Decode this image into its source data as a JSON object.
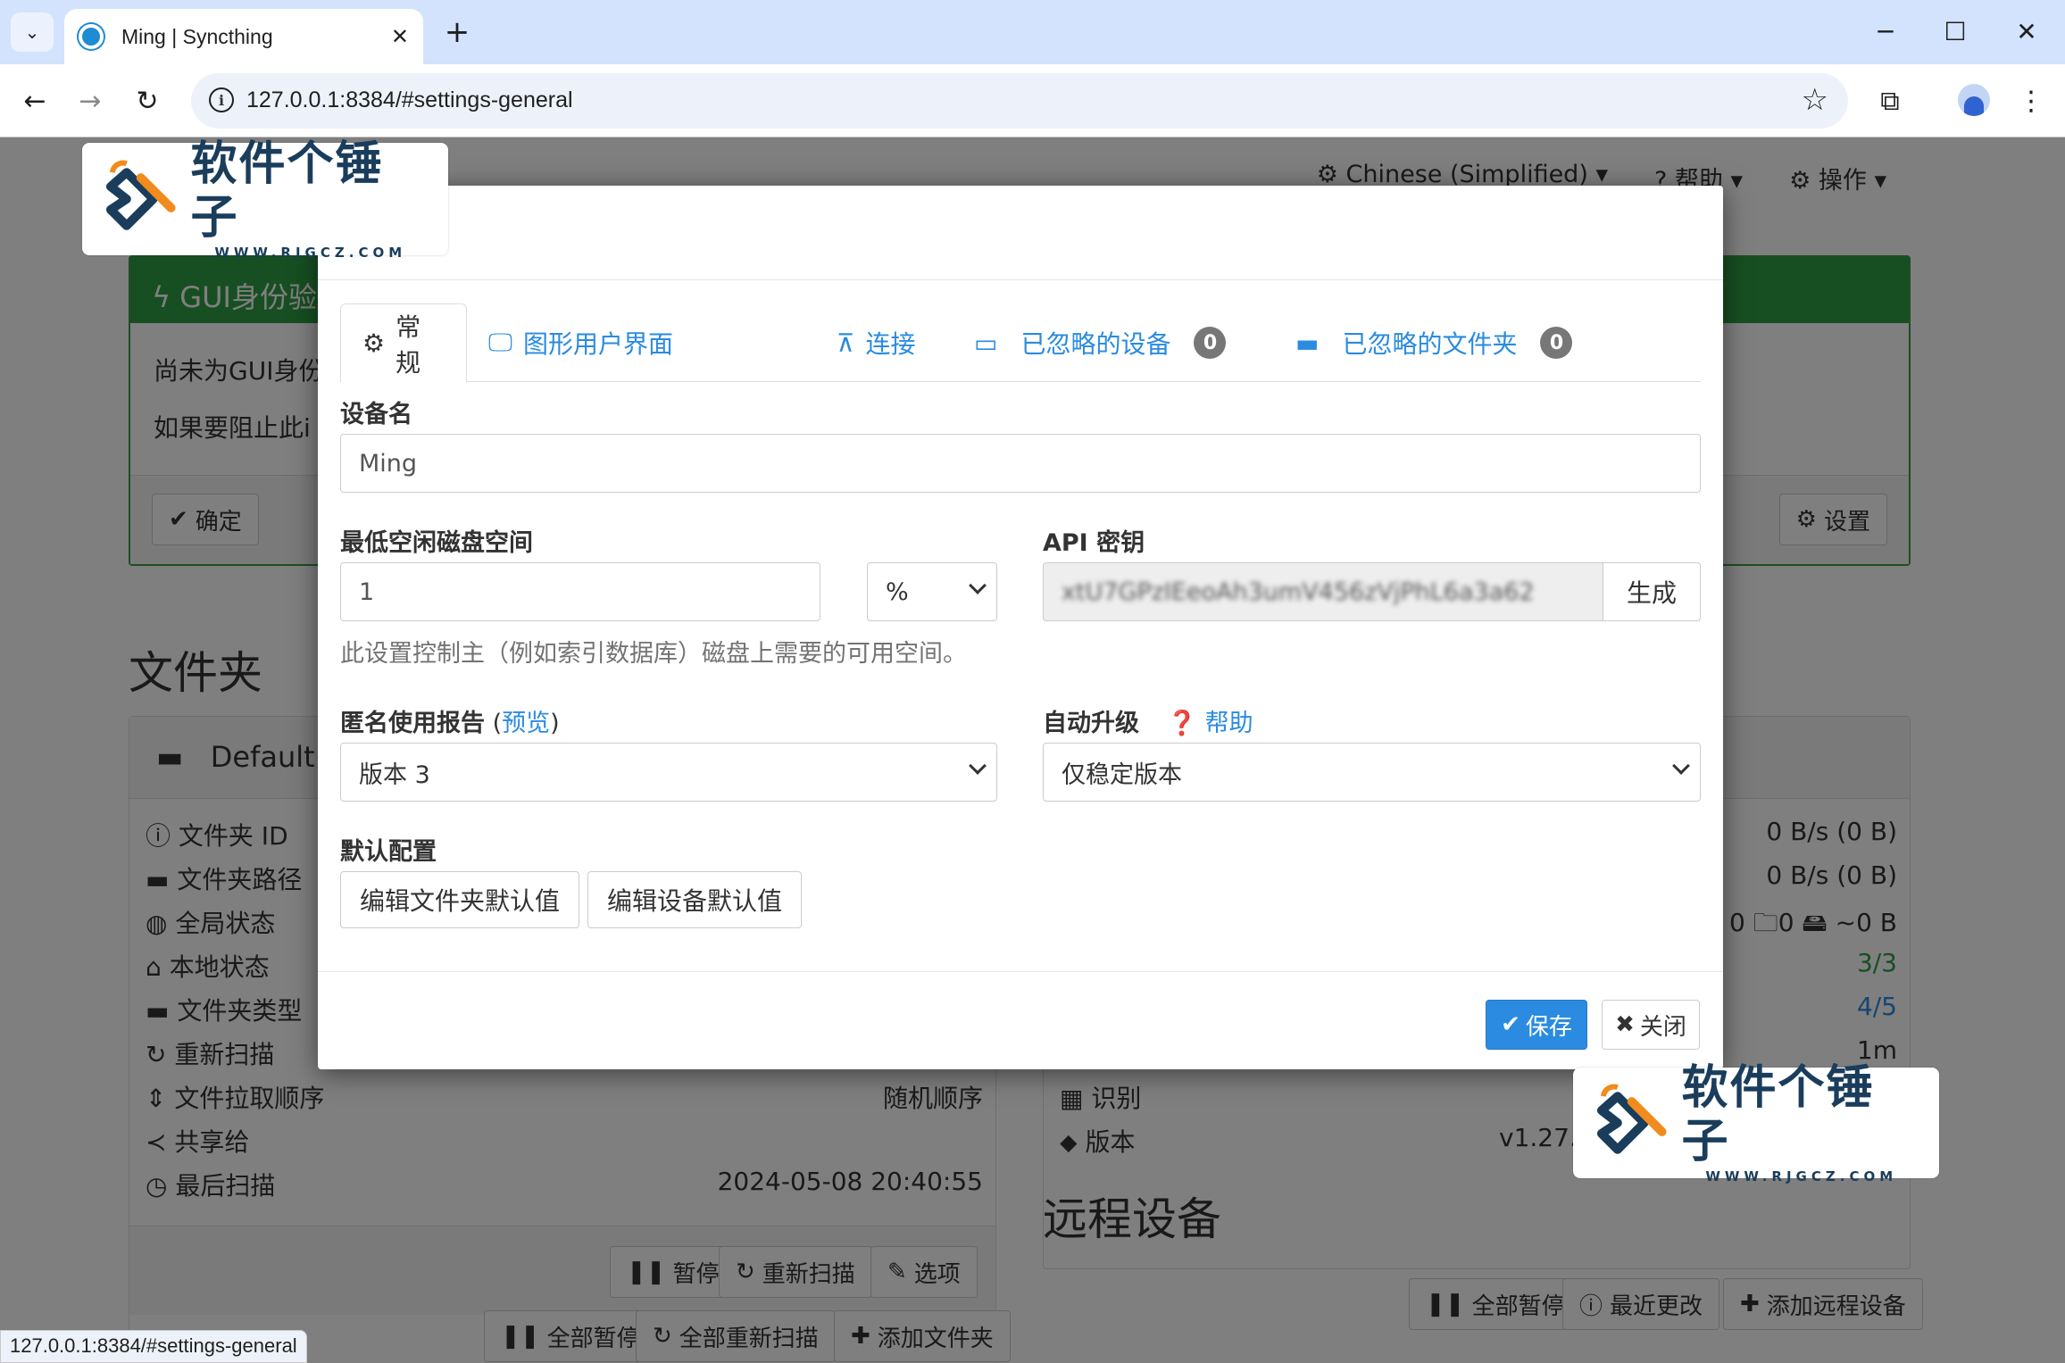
{
  "browser": {
    "tab_title": "Ming | Syncthing",
    "url": "127.0.0.1:8384/#settings-general",
    "status_url": "127.0.0.1:8384/#settings-general"
  },
  "navbar": {
    "language": "Chinese (Simplified)",
    "help": "帮助",
    "actions": "操作"
  },
  "alert": {
    "title": "GUI身份验证",
    "line1": "尚未为GUI身份",
    "line2": "如果要阻止此i",
    "ok_button": "确定",
    "settings_button": "设置"
  },
  "folders": {
    "section_title": "文件夹",
    "folder_name": "Default",
    "rows": [
      {
        "label": "文件夹 ID",
        "value": ""
      },
      {
        "label": "文件夹路径",
        "value": ""
      },
      {
        "label": "全局状态",
        "value": ""
      },
      {
        "label": "本地状态",
        "value": ""
      },
      {
        "label": "文件夹类型",
        "value": ""
      },
      {
        "label": "重新扫描",
        "value": ""
      },
      {
        "label": "文件拉取顺序",
        "value": "随机顺序"
      },
      {
        "label": "共享给",
        "value": ""
      },
      {
        "label": "最后扫描",
        "value": "2024-05-08 20:40:55"
      }
    ],
    "pause_button": "暂停",
    "rescan_button": "重新扫描",
    "options_button": "选项",
    "pause_all_button": "全部暂停",
    "rescan_all_button": "全部重新扫描",
    "add_folder_button": "添加文件夹"
  },
  "this_device": {
    "rows": [
      {
        "value": "0 B/s (0 B)"
      },
      {
        "value": "0 B/s (0 B)"
      },
      {
        "value": "0  🗀0  🖴 ~0 B"
      },
      {
        "value": "3/3"
      },
      {
        "value": "4/5"
      },
      {
        "value": "1m"
      }
    ],
    "id_label": "识别",
    "version_label": "版本",
    "version_value": "v1.27.7"
  },
  "remote": {
    "section_title": "远程设备",
    "pause_all_button": "全部暂停",
    "recent_changes_button": "最近更改",
    "add_device_button": "添加远程设备"
  },
  "modal": {
    "tabs": [
      {
        "label": "常规",
        "icon": "gear-icon"
      },
      {
        "label": "图形用户界面",
        "icon": "desktop-icon"
      },
      {
        "label": "连接",
        "icon": "sitemap-icon"
      },
      {
        "label": "已忽略的设备",
        "icon": "laptop-icon",
        "badge": "0"
      },
      {
        "label": "已忽略的文件夹",
        "icon": "folder-icon",
        "badge": "0"
      }
    ],
    "device_name_label": "设备名",
    "device_name_value": "Ming",
    "min_disk_label": "最低空闲磁盘空间",
    "min_disk_value": "1",
    "min_disk_unit": "%",
    "min_disk_help": "此设置控制主（例如索引数据库）磁盘上需要的可用空间。",
    "api_key_label": "API 密钥",
    "api_key_value": "xtU7GPzIEeoAh3umV456zVjPhL6a3a62",
    "generate_button": "生成",
    "usage_label": "匿名使用报告",
    "usage_preview_open": " (",
    "usage_preview_link": "预览",
    "usage_preview_close": ")",
    "usage_value": "版本 3",
    "auto_upgrade_label": "自动升级",
    "auto_upgrade_help": "帮助",
    "auto_upgrade_value": "仅稳定版本",
    "defaults_label": "默认配置",
    "edit_folder_defaults": "编辑文件夹默认值",
    "edit_device_defaults": "编辑设备默认值",
    "save_button": "保存",
    "close_button": "关闭"
  },
  "watermark": {
    "main": "软件个锤子",
    "sub": "WWW.RJGCZ.COM"
  },
  "colors": {
    "accent": "#2a8be0",
    "alert_green": "#2f9e44",
    "badge_gray": "#777777"
  }
}
